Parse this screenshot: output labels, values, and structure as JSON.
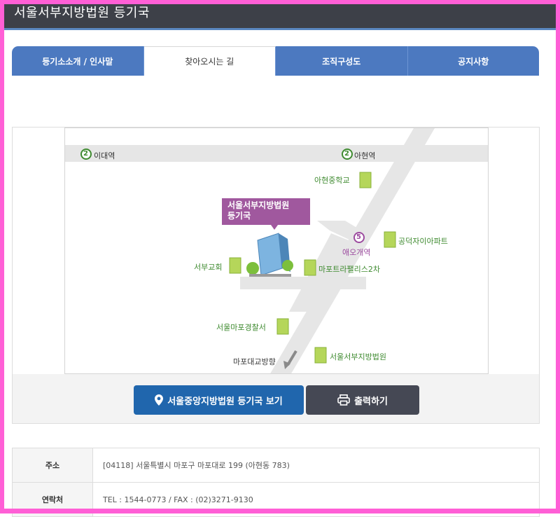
{
  "header": {
    "title": "서울서부지방법원  등기국"
  },
  "tabs": [
    {
      "label": "등기소소개 / 인사말"
    },
    {
      "label": "찾아오시는 길"
    },
    {
      "label": "조직구성도"
    },
    {
      "label": "공지사항"
    }
  ],
  "map": {
    "callout": [
      "서울서부지방법원",
      "등기국"
    ],
    "stations": {
      "line2_number": "2",
      "line5_number": "5",
      "idae": "이대역",
      "ahyeon": "아현역",
      "aeogae": "애오개역"
    },
    "landmarks": {
      "ahyeon_middle": "아현중학교",
      "gongdeok_xi": "공덕자이아파트",
      "seobu_church": "서부교회",
      "mapo_trapalace": "마포트라팰리스2차",
      "mapo_police": "서울마포경찰서",
      "seobu_court": "서울서부지방법원",
      "mapo_bridge_dir": "마포대교방향"
    }
  },
  "buttons": {
    "view_central": "서울중앙지방법원 등기국 보기",
    "print": "출력하기"
  },
  "info": {
    "address_label": "주소",
    "address_value": "[04118] 서울특별시 마포구 마포대로 199 (아현동 783)",
    "contact_label": "연락처",
    "contact_value": "TEL : 1544-0773 / FAX : (02)3271-9130"
  },
  "colors": {
    "header_bg": "#3d4048",
    "tab_blue": "#4c79c0",
    "btn_blue": "#2066ad",
    "btn_dark": "#454854",
    "callout_purple": "#a0589e",
    "line2_green": "#3e8a2f",
    "line5_purple": "#9c4b9f"
  }
}
